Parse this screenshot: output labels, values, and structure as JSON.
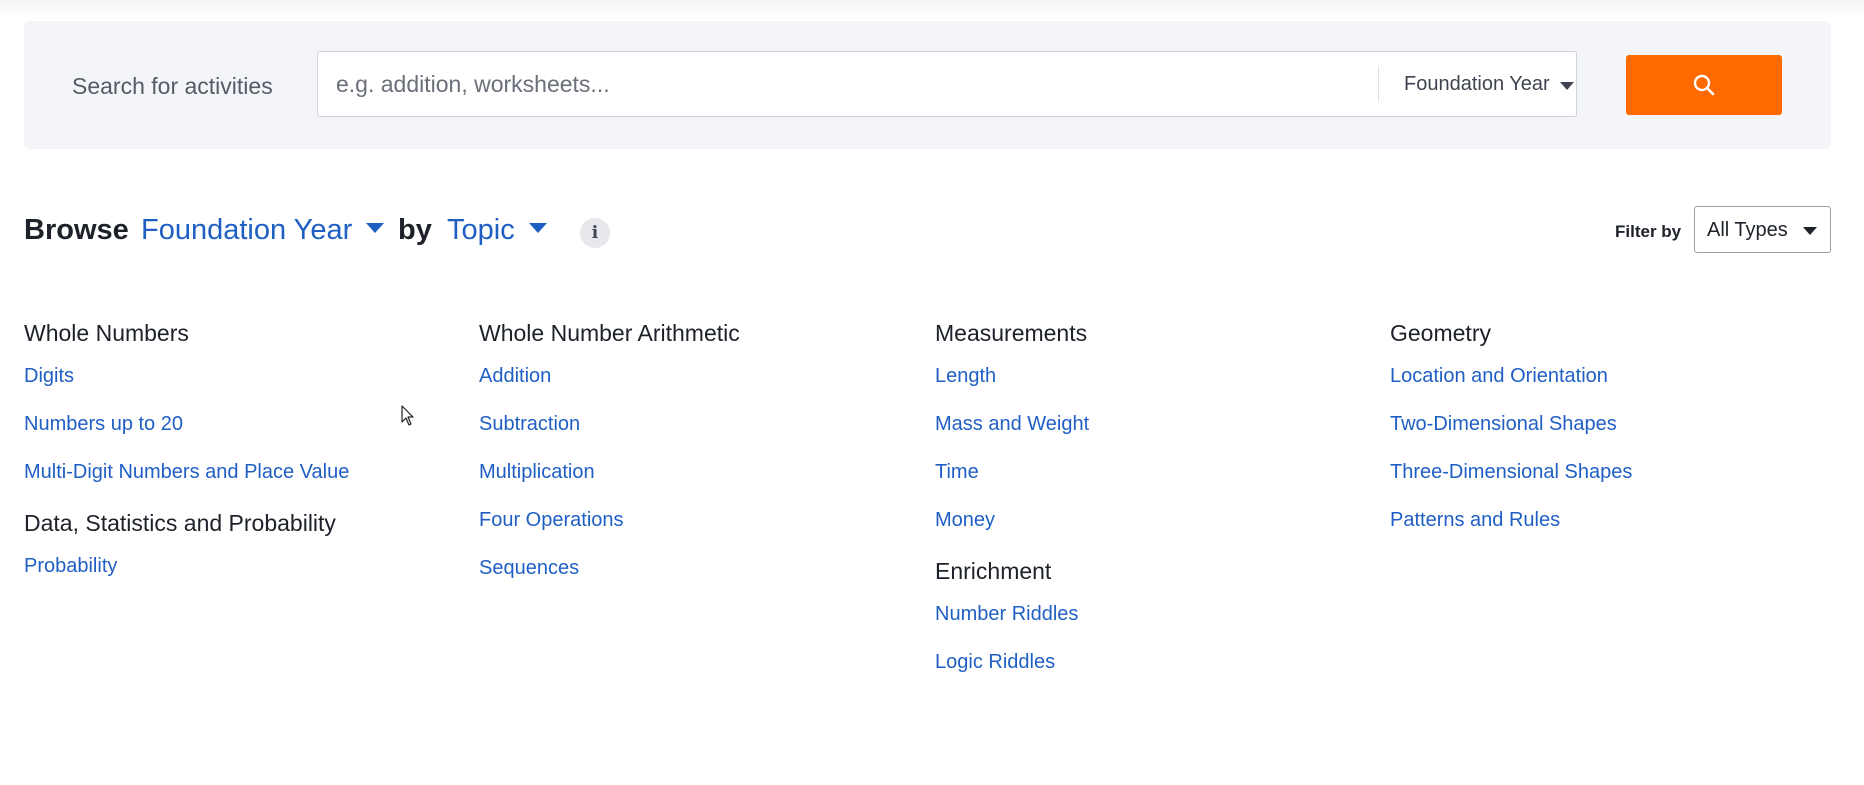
{
  "search": {
    "label": "Search for activities",
    "placeholder": "e.g. addition, worksheets...",
    "value": "",
    "year_selected": "Foundation Year",
    "button_icon": "search-icon",
    "button_color": "#ff6a00"
  },
  "browse": {
    "word": "Browse",
    "year": "Foundation Year",
    "by_word": "by",
    "mode": "Topic",
    "info_icon": "info-icon",
    "filter_label": "Filter by",
    "filter_value": "All Types"
  },
  "colors": {
    "link": "#1f5fc4",
    "heading": "#1d2129",
    "panel_bg": "#f4f5f8"
  },
  "columns": [
    {
      "groups": [
        {
          "title": "Whole Numbers",
          "items": [
            "Digits",
            "Numbers up to 20",
            "Multi-Digit Numbers and Place Value"
          ]
        },
        {
          "title": "Data, Statistics and Probability",
          "items": [
            "Probability"
          ]
        }
      ]
    },
    {
      "groups": [
        {
          "title": "Whole Number Arithmetic",
          "items": [
            "Addition",
            "Subtraction",
            "Multiplication",
            "Four Operations",
            "Sequences"
          ]
        }
      ]
    },
    {
      "groups": [
        {
          "title": "Measurements",
          "items": [
            "Length",
            "Mass and Weight",
            "Time",
            "Money"
          ]
        },
        {
          "title": "Enrichment",
          "items": [
            "Number Riddles",
            "Logic Riddles"
          ]
        }
      ]
    },
    {
      "groups": [
        {
          "title": "Geometry",
          "items": [
            "Location and Orientation",
            "Two-Dimensional Shapes",
            "Three-Dimensional Shapes",
            "Patterns and Rules"
          ]
        }
      ]
    }
  ]
}
